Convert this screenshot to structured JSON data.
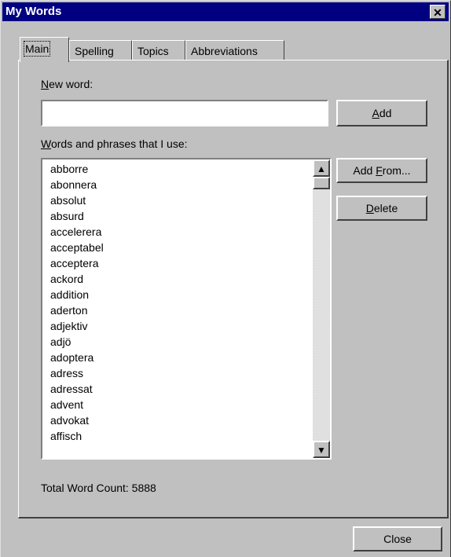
{
  "window": {
    "title": "My Words",
    "close_glyph": "✕"
  },
  "tabs": [
    {
      "label": "Main"
    },
    {
      "label": "Spelling"
    },
    {
      "label": "Topics"
    },
    {
      "label": "Abbreviations"
    }
  ],
  "main": {
    "new_word_label_key": "N",
    "new_word_label_rest": "ew word:",
    "new_word_value": "",
    "add_key": "A",
    "add_rest": "dd",
    "list_label_key": "W",
    "list_label_rest": "ords and phrases that I use:",
    "add_from_prefix": "Add ",
    "add_from_key": "F",
    "add_from_rest": "rom...",
    "delete_key": "D",
    "delete_rest": "elete",
    "words": [
      "abborre",
      "abonnera",
      "absolut",
      "absurd",
      "accelerera",
      "acceptabel",
      "acceptera",
      "ackord",
      "addition",
      "aderton",
      "adjektiv",
      "adjö",
      "adoptera",
      "adress",
      "adressat",
      "advent",
      "advokat",
      "affisch"
    ],
    "total_label": "Total Word Count: 5888"
  },
  "footer": {
    "close_label": "Close"
  },
  "icons": {
    "scroll_up": "▲",
    "scroll_down": "▼"
  }
}
